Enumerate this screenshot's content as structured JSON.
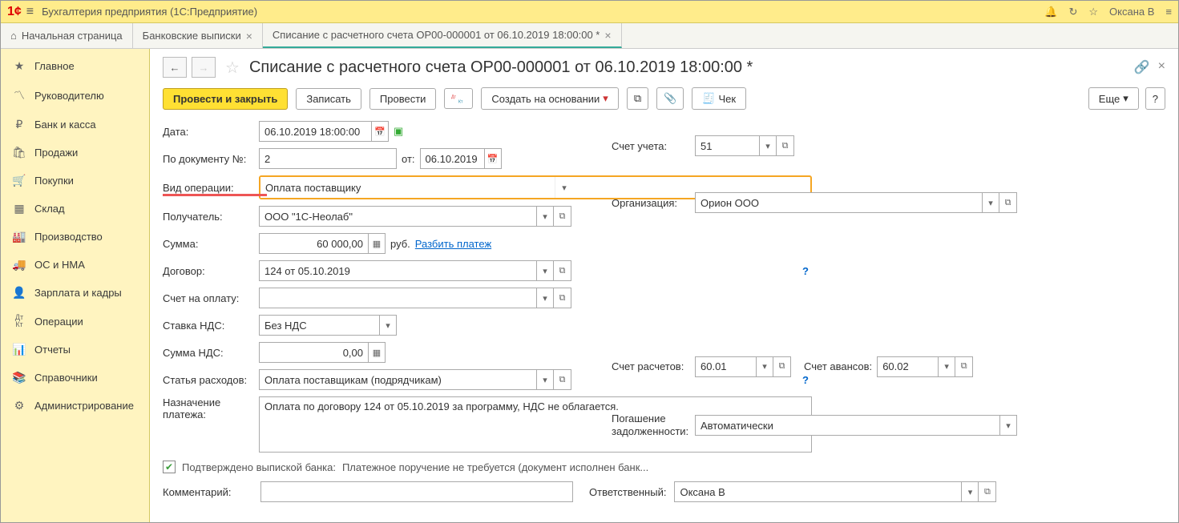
{
  "titlebar": {
    "app_title": "Бухгалтерия предприятия  (1С:Предприятие)",
    "user": "Оксана В"
  },
  "tabs": {
    "home": "Начальная страница",
    "t1": "Банковские выписки",
    "t2": "Списание с расчетного счета ОР00-000001 от 06.10.2019 18:00:00 *"
  },
  "sidebar": [
    {
      "icon": "★",
      "label": "Главное"
    },
    {
      "icon": "📈",
      "label": "Руководителю"
    },
    {
      "icon": "₽",
      "label": "Банк и касса"
    },
    {
      "icon": "🛍",
      "label": "Продажи"
    },
    {
      "icon": "🛒",
      "label": "Покупки"
    },
    {
      "icon": "▥",
      "label": "Склад"
    },
    {
      "icon": "🏭",
      "label": "Производство"
    },
    {
      "icon": "🚚",
      "label": "ОС и НМА"
    },
    {
      "icon": "👤",
      "label": "Зарплата и кадры"
    },
    {
      "icon": "ДтКт",
      "label": "Операции"
    },
    {
      "icon": "📊",
      "label": "Отчеты"
    },
    {
      "icon": "📚",
      "label": "Справочники"
    },
    {
      "icon": "⚙",
      "label": "Администрирование"
    }
  ],
  "header": {
    "title": "Списание с расчетного счета ОР00-000001 от 06.10.2019 18:00:00 *"
  },
  "toolbar": {
    "post_close": "Провести и закрыть",
    "save": "Записать",
    "post": "Провести",
    "create_based": "Создать на основании",
    "check": "Чек",
    "more": "Еще",
    "help": "?"
  },
  "form": {
    "date_lbl": "Дата:",
    "date_val": "06.10.2019 18:00:00",
    "acct_lbl": "Счет учета:",
    "acct_val": "51",
    "docnum_lbl": "По документу №:",
    "docnum_val": "2",
    "docdate_lbl": "от:",
    "docdate_val": "06.10.2019",
    "org_lbl": "Организация:",
    "org_val": "Орион ООО",
    "optype_lbl": "Вид операции:",
    "optype_val": "Оплата поставщику",
    "recipient_lbl": "Получатель:",
    "recipient_val": "ООО \"1С-Неолаб\"",
    "sum_lbl": "Сумма:",
    "sum_val": "60 000,00",
    "sum_cur": "руб.",
    "split_link": "Разбить платеж",
    "contract_lbl": "Договор:",
    "contract_val": "124 от 05.10.2019",
    "settle_acct_lbl": "Счет расчетов:",
    "settle_acct_val": "60.01",
    "advance_acct_lbl": "Счет авансов:",
    "advance_acct_val": "60.02",
    "invoice_lbl": "Счет на оплату:",
    "invoice_val": "",
    "debt_lbl": "Погашение задолженности:",
    "debt_val": "Автоматически",
    "vat_rate_lbl": "Ставка НДС:",
    "vat_rate_val": "Без НДС",
    "vat_sum_lbl": "Сумма НДС:",
    "vat_sum_val": "0,00",
    "expense_lbl": "Статья расходов:",
    "expense_val": "Оплата поставщикам (подрядчикам)",
    "purpose_lbl": "Назначение платежа:",
    "purpose_val": "Оплата по договору 124 от 05.10.2019 за программу, НДС не облагается.",
    "confirmed_lbl": "Подтверждено выпиской банка:",
    "confirmed_text": "Платежное поручение не требуется (документ исполнен банк...",
    "comment_lbl": "Комментарий:",
    "comment_val": "",
    "resp_lbl": "Ответственный:",
    "resp_val": "Оксана В"
  }
}
